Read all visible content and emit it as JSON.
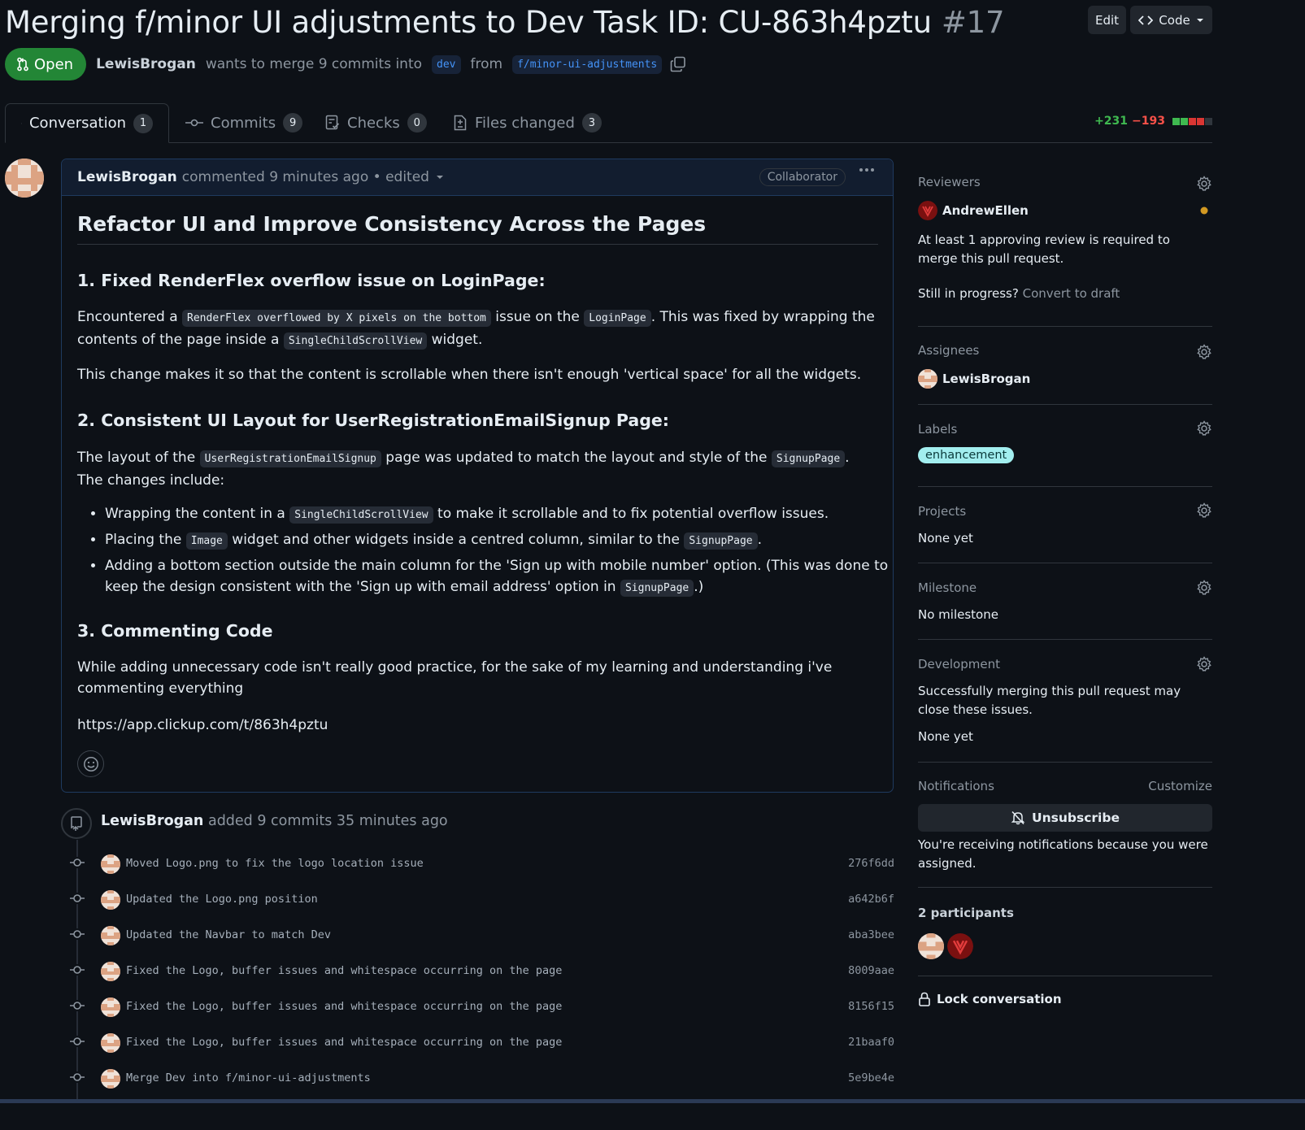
{
  "pr": {
    "title": "Merging f/minor UI adjustments to Dev Task ID: CU-863h4pztu",
    "number": "#17",
    "edit_label": "Edit",
    "code_label": "Code",
    "state": "Open",
    "author": "LewisBrogan",
    "merge_text": "wants to merge 9 commits into",
    "base_branch": "dev",
    "from_text": "from",
    "head_branch": "f/minor-ui-adjustments"
  },
  "tabs": [
    {
      "label": "Conversation",
      "count": "1"
    },
    {
      "label": "Commits",
      "count": "9"
    },
    {
      "label": "Checks",
      "count": "0"
    },
    {
      "label": "Files changed",
      "count": "3"
    }
  ],
  "diffstat": {
    "additions": "+231",
    "deletions": "−193"
  },
  "comment": {
    "author": "LewisBrogan",
    "meta": "commented 9 minutes ago • edited",
    "badge": "Collaborator",
    "heading": "Refactor UI and Improve Consistency Across the Pages",
    "s1_title": "1. Fixed RenderFlex overflow issue on LoginPage:",
    "s1_p1_a": "Encountered a",
    "s1_p1_code1": "RenderFlex overflowed by X pixels on the bottom",
    "s1_p1_b": "issue on the",
    "s1_p1_code2": "LoginPage",
    "s1_p1_c": ". This was fixed by wrapping the contents of the page inside a",
    "s1_p1_code3": "SingleChildScrollView",
    "s1_p1_d": "widget.",
    "s1_p2": "This change makes it so that the content is scrollable when there isn't enough 'vertical space' for all the widgets.",
    "s2_title": "2. Consistent UI Layout for UserRegistrationEmailSignup Page:",
    "s2_p1_a": "The layout of the",
    "s2_p1_code1": "UserRegistrationEmailSignup",
    "s2_p1_b": "page was updated to match the layout and style of the",
    "s2_p1_code2": "SignupPage",
    "s2_p1_c": ". The changes include:",
    "b1_a": "Wrapping the content in a",
    "b1_code": "SingleChildScrollView",
    "b1_b": "to make it scrollable and to fix potential overflow issues.",
    "b2_a": "Placing the",
    "b2_code1": "Image",
    "b2_b": "widget and other widgets inside a centred column, similar to the",
    "b2_code2": "SignupPage",
    "b2_c": ".",
    "b3_a": "Adding a bottom section outside the main column for the 'Sign up with mobile number' option. (This was done to keep the design consistent with the 'Sign up with email address' option in",
    "b3_code": "SignupPage",
    "b3_b": ".)",
    "s3_title": "3. Commenting Code",
    "s3_p1": "While adding unnecessary code isn't really good practice, for the sake of my learning and understanding i've commenting everything",
    "link": "https://app.clickup.com/t/863h4pztu"
  },
  "push_event": {
    "author": "LewisBrogan",
    "text": "added 9 commits 35 minutes ago"
  },
  "commits": [
    {
      "message": "Moved Logo.png to fix the logo location issue",
      "sha": "276f6dd"
    },
    {
      "message": "Updated the Logo.png position",
      "sha": "a642b6f"
    },
    {
      "message": "Updated the Navbar to match Dev",
      "sha": "aba3bee"
    },
    {
      "message": "Fixed the Logo, buffer issues and whitespace occurring on the page",
      "sha": "8009aae"
    },
    {
      "message": "Fixed the Logo, buffer issues and whitespace occurring on the page",
      "sha": "8156f15"
    },
    {
      "message": "Fixed the Logo, buffer issues and whitespace occurring on the page",
      "sha": "21baaf0"
    },
    {
      "message": "Merge Dev into f/minor-ui-adjustments",
      "sha": "5e9be4e"
    }
  ],
  "sidebar": {
    "reviewers_title": "Reviewers",
    "reviewer": "AndrewEllen",
    "review_required": "At least 1 approving review is required to merge this pull request.",
    "in_progress": "Still in progress?",
    "convert_draft": "Convert to draft",
    "assignees_title": "Assignees",
    "assignee": "LewisBrogan",
    "labels_title": "Labels",
    "label": "enhancement",
    "projects_title": "Projects",
    "projects_value": "None yet",
    "milestone_title": "Milestone",
    "milestone_value": "No milestone",
    "development_title": "Development",
    "development_text": "Successfully merging this pull request may close these issues.",
    "development_value": "None yet",
    "notifications_title": "Notifications",
    "customize": "Customize",
    "unsubscribe": "Unsubscribe",
    "notif_reason": "You're receiving notifications because you were assigned.",
    "participants": "2 participants",
    "lock": "Lock conversation"
  },
  "colors": {
    "open": "#238636",
    "link": "#4493f8",
    "label_bg": "#a2eeef",
    "add": "#3fb950",
    "del": "#f85149"
  }
}
